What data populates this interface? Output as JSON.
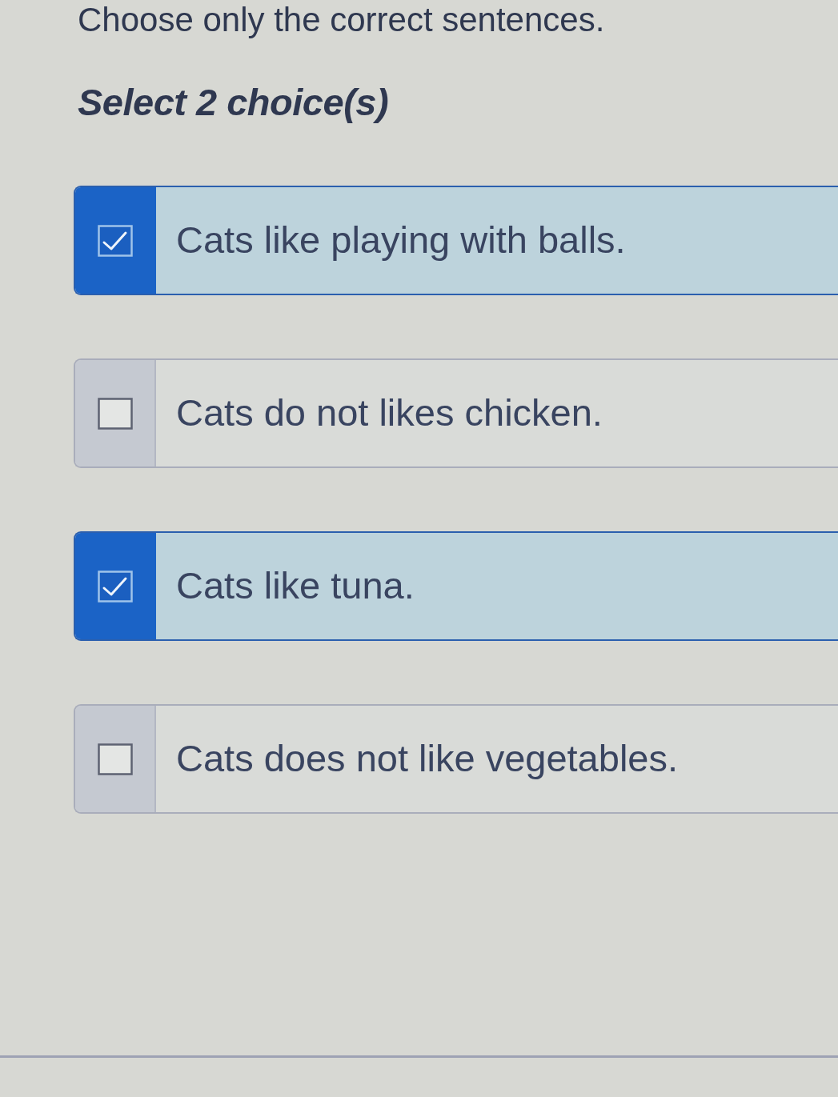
{
  "question": {
    "prompt": "Choose only the correct sentences.",
    "instruction": "Select 2 choice(s)"
  },
  "choices": [
    {
      "text": "Cats like playing with balls.",
      "checked": true
    },
    {
      "text": "Cats do not likes chicken.",
      "checked": false
    },
    {
      "text": "Cats like tuna.",
      "checked": true
    },
    {
      "text": "Cats does not like vegetables.",
      "checked": false
    }
  ]
}
